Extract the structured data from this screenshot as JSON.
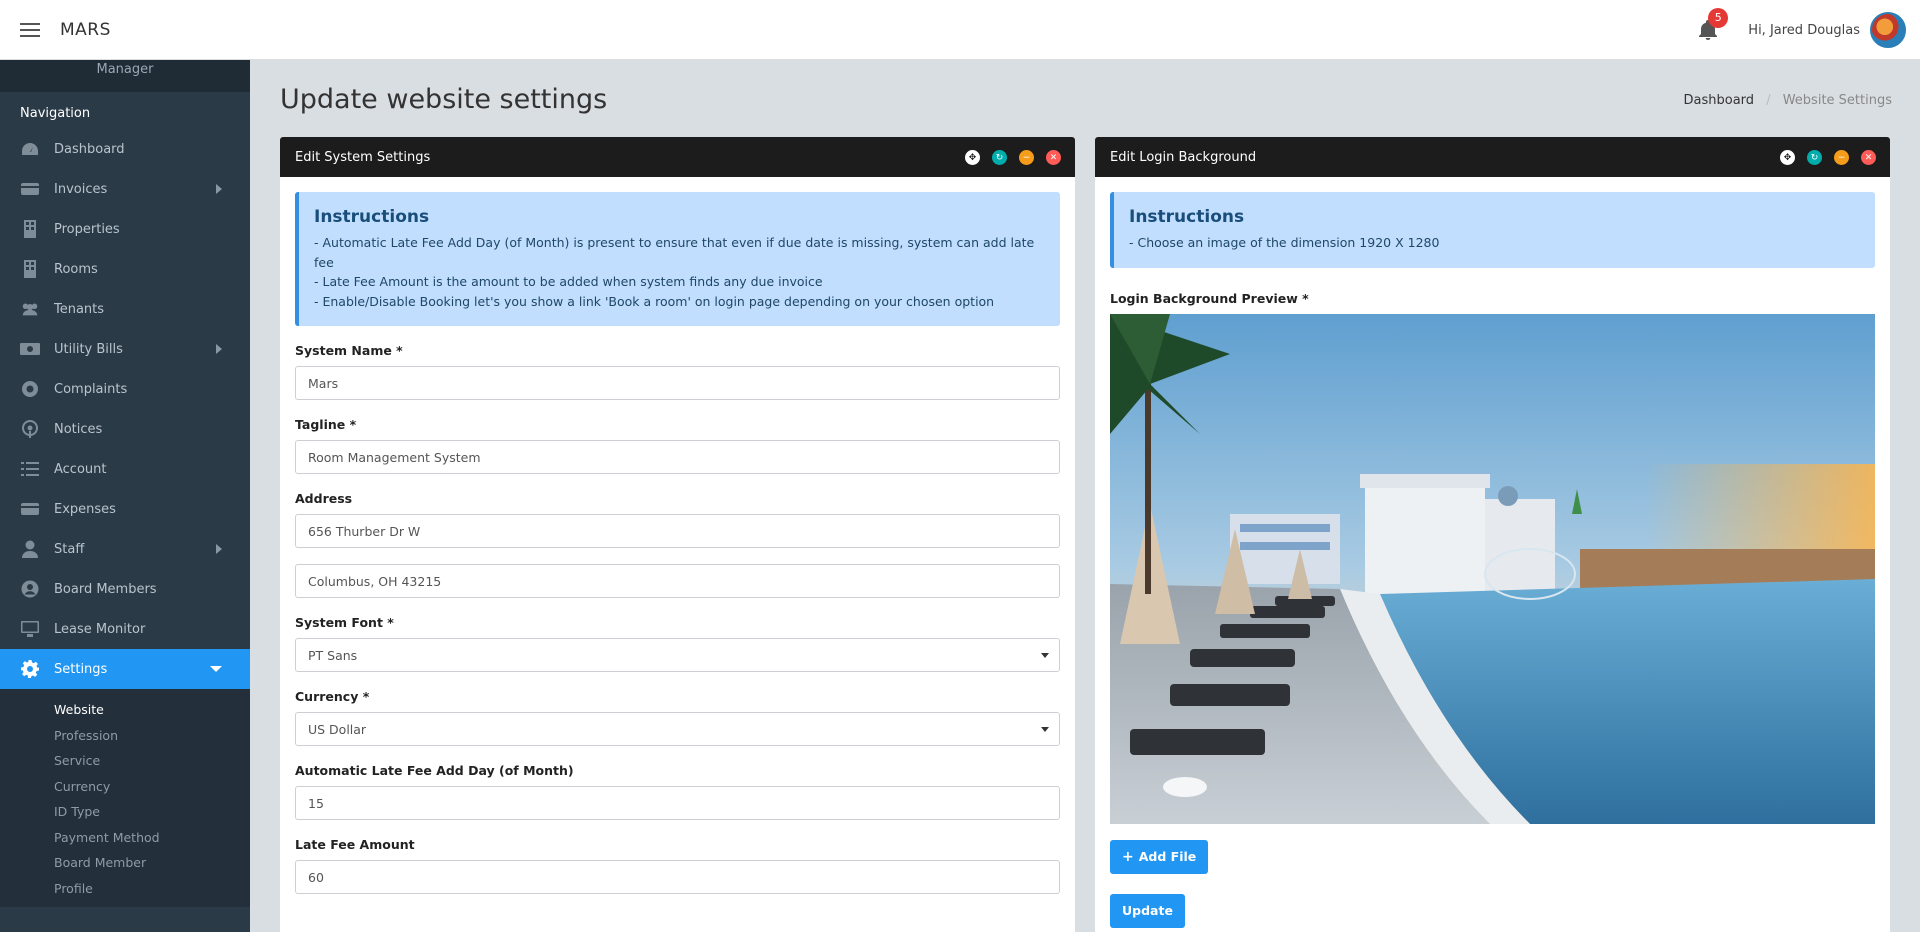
{
  "topbar": {
    "brand": "MARS",
    "notification_count": "5",
    "greeting": "Hi, Jared Douglas"
  },
  "sidebar": {
    "profile_role": "Manager",
    "nav_header": "Navigation",
    "items": [
      {
        "label": "Dashboard",
        "icon": "dashboard-icon"
      },
      {
        "label": "Invoices",
        "icon": "credit-card-icon"
      },
      {
        "label": "Properties",
        "icon": "building-icon"
      },
      {
        "label": "Rooms",
        "icon": "building-icon"
      },
      {
        "label": "Tenants",
        "icon": "users-icon"
      },
      {
        "label": "Utility Bills",
        "icon": "money-icon"
      },
      {
        "label": "Complaints",
        "icon": "life-ring-icon"
      },
      {
        "label": "Notices",
        "icon": "podcast-icon"
      },
      {
        "label": "Account",
        "icon": "list-icon"
      },
      {
        "label": "Expenses",
        "icon": "credit-card-icon"
      },
      {
        "label": "Staff",
        "icon": "user-icon"
      },
      {
        "label": "Board Members",
        "icon": "user-circle-icon"
      },
      {
        "label": "Lease Monitor",
        "icon": "desktop-icon"
      },
      {
        "label": "Settings",
        "icon": "gear-icon"
      }
    ],
    "settings_sub": [
      "Website",
      "Profession",
      "Service",
      "Currency",
      "ID Type",
      "Payment Method",
      "Board Member",
      "Profile"
    ]
  },
  "page": {
    "title": "Update website settings",
    "breadcrumb": [
      "Dashboard",
      "Website Settings"
    ]
  },
  "system_panel": {
    "title": "Edit System Settings",
    "instructions_title": "Instructions",
    "instructions": [
      "- Automatic Late Fee Add Day (of Month) is present to ensure that even if due date is missing, system can add late fee",
      "- Late Fee Amount is the amount to be added when system finds any due invoice",
      "- Enable/Disable Booking let's you show a link 'Book a room' on login page depending on your chosen option"
    ],
    "system_name_label": "System Name *",
    "system_name": "Mars",
    "tagline_label": "Tagline *",
    "tagline": "Room Management System",
    "address_label": "Address",
    "address_line1": "656 Thurber Dr W",
    "address_line2": "Columbus, OH 43215",
    "font_label": "System Font *",
    "font_value": "PT Sans",
    "currency_label": "Currency *",
    "currency_value": "US Dollar",
    "late_day_label": "Automatic Late Fee Add Day (of Month)",
    "late_day_value": "15",
    "late_amount_label": "Late Fee Amount",
    "late_amount_value": "60"
  },
  "login_panel": {
    "title": "Edit Login Background",
    "instructions_title": "Instructions",
    "instructions": [
      "- Choose an image of the dimension 1920 X 1280"
    ],
    "preview_label": "Login Background Preview *",
    "add_file": "Add File",
    "update": "Update"
  },
  "colors": {
    "accent": "#2196f3",
    "sidebar": "#2b3a47",
    "panel_heading": "#1c1c1c"
  }
}
